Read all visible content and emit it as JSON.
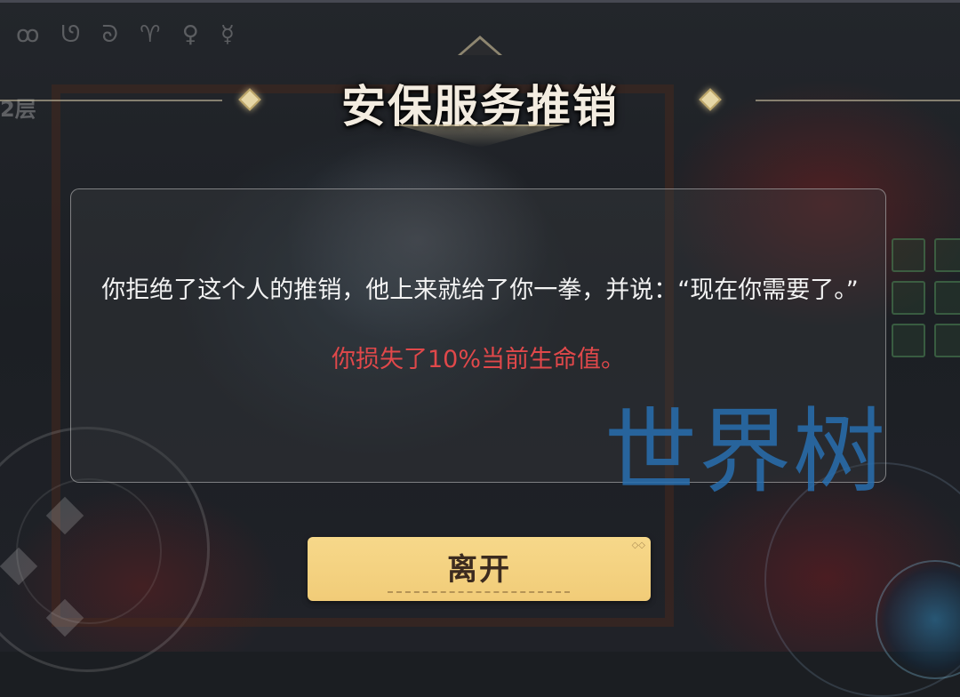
{
  "hud": {
    "floor_label": "2层",
    "runes": "ꝏ ᘎ ᘐ ♈ ♀ ☿"
  },
  "event": {
    "title": "安保服务推销",
    "message": "你拒绝了这个人的推销，他上来就给了你一拳，并说：“现在你需要了。”",
    "penalty": "你损失了10%当前生命值。",
    "penalty_color": "#e0484a"
  },
  "leave_button": {
    "label": "离开"
  },
  "watermark": {
    "text": "世界树"
  },
  "colors": {
    "button_fill": "#f3d17f",
    "title_text": "#f3ece0",
    "watermark": "#286eaf"
  }
}
